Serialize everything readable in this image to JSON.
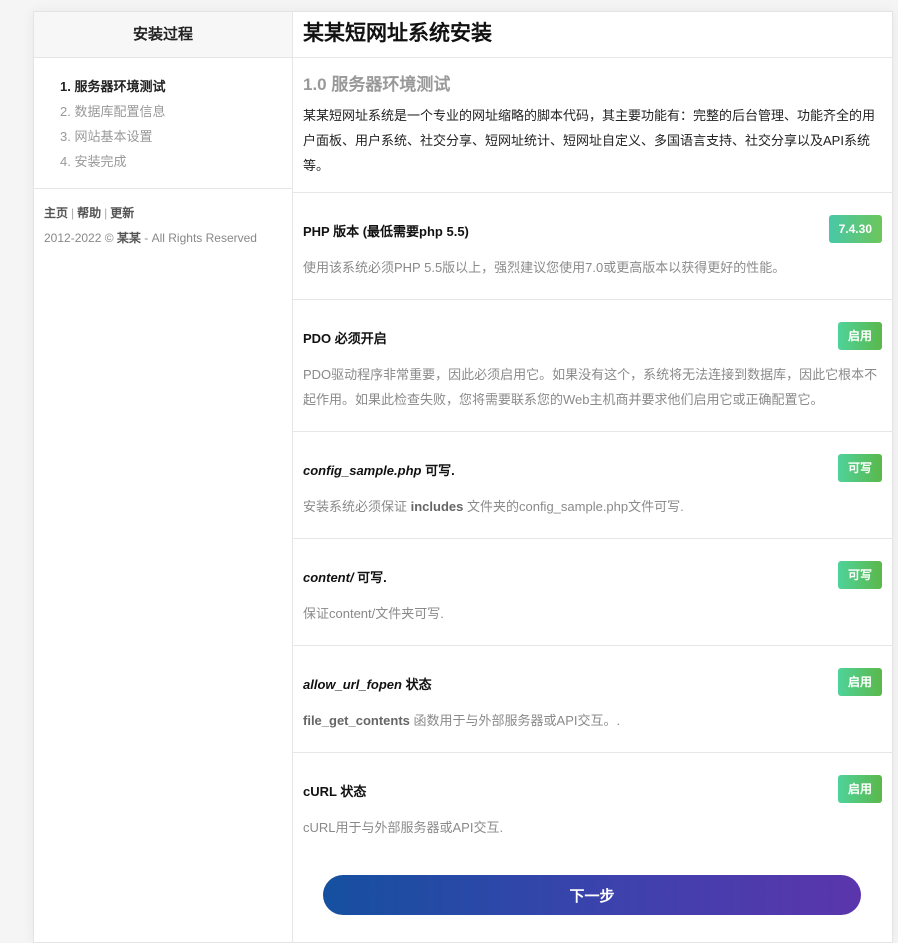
{
  "sidebar": {
    "title": "安装过程",
    "steps": [
      "1. 服务器环境测试",
      "2. 数据库配置信息",
      "3. 网站基本设置",
      "4. 安装完成"
    ],
    "links": [
      "主页",
      "帮助",
      "更新"
    ],
    "copyright_prefix": "2012-2022 ©",
    "copyright_name": "某某",
    "copyright_suffix": "- All Rights Reserved"
  },
  "main": {
    "title": "某某短网址系统安装",
    "section_heading": "1.0 服务器环境测试",
    "intro": "某某短网址系统是一个专业的网址缩略的脚本代码，其主要功能有：完整的后台管理、功能齐全的用户面板、用户系统、社交分享、短网址统计、短网址自定义、多国语言支持、社交分享以及API系统等。",
    "requirements": [
      {
        "title": "PHP 版本 (最低需要php 5.5)",
        "badge": "7.4.30",
        "desc": "使用该系统必须PHP 5.5版以上，强烈建议您使用7.0或更高版本以获得更好的性能。"
      },
      {
        "title": "PDO 必须开启",
        "badge": "启用",
        "desc": "PDO驱动程序非常重要，因此必须启用它。如果没有这个，系统将无法连接到数据库，因此它根本不起作用。如果此检查失败，您将需要联系您的Web主机商并要求他们启用它或正确配置它。"
      },
      {
        "title_em": "config_sample.php",
        "title_rest": " 可写.",
        "badge": "可写",
        "desc_pre": "安装系统必须保证 ",
        "desc_strong": "includes",
        "desc_post": " 文件夹的config_sample.php文件可写."
      },
      {
        "title_em": "content/",
        "title_rest": " 可写.",
        "badge": "可写",
        "desc": "保证content/文件夹可写."
      },
      {
        "title_em": "allow_url_fopen",
        "title_rest": " 状态",
        "badge": "启用",
        "desc_strong": "file_get_contents",
        "desc_post": " 函数用于与外部服务器或API交互。."
      },
      {
        "title": "cURL 状态",
        "badge": "启用",
        "desc": "cURL用于与外部服务器或API交互."
      }
    ],
    "next_button": "下一步"
  },
  "colors": {
    "badge_green": "#5ab84a",
    "button_start": "#1550a0",
    "button_end": "#5b35ac"
  }
}
